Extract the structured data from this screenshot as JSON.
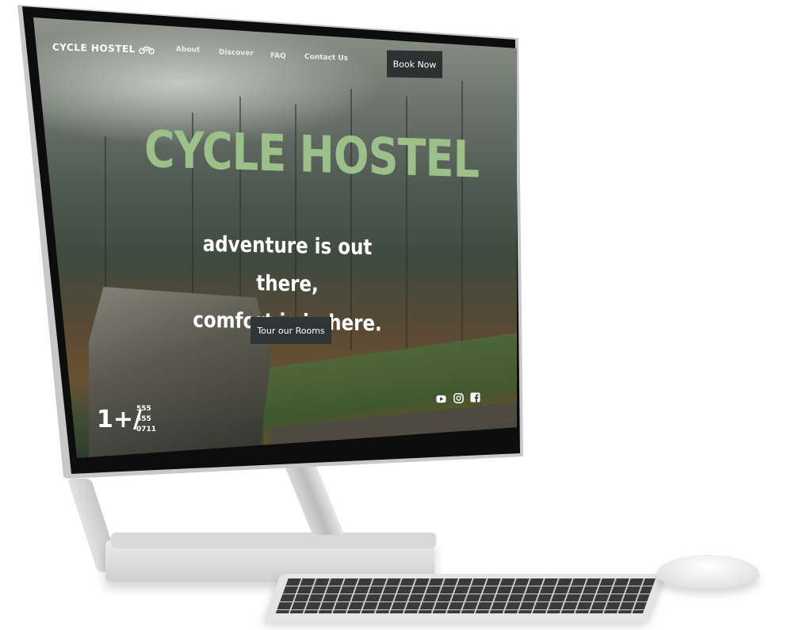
{
  "site": {
    "logo_text": "CYCLE HOSTEL",
    "nav": [
      "About",
      "Discover",
      "FAQ",
      "Contact Us"
    ],
    "book_label": "Book Now",
    "hero_title": "CYCLE HOSTEL",
    "hero_line1": "adventure is out there,",
    "hero_line2": "comfort is in here.",
    "tour_label": "Tour our Rooms",
    "phone_prefix": "1+/",
    "phone_lines": [
      "555",
      "555",
      "0711"
    ],
    "social_icons": [
      "youtube-icon",
      "instagram-icon",
      "facebook-icon"
    ]
  },
  "colors": {
    "title_green": "#9dbf8a",
    "button_dark": "#2b3231"
  }
}
